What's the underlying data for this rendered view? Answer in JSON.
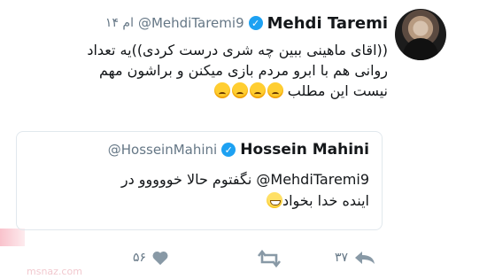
{
  "tweet": {
    "name": "Mehdi Taremi",
    "handle": "@MehdiTaremi9",
    "time": "۱۴ ام",
    "verified_glyph": "✓",
    "line1": "((اقای ماهینی ببین چه شری درست کردی))یه تعداد",
    "line2": "روانی هم با ابرو مردم بازی میکنن و براشون مهم",
    "line3": "نیست این مطلب",
    "emoji_name": "pouting-face"
  },
  "quote": {
    "name": "Hossein Mahini",
    "handle": "@HosseinMahini",
    "verified_glyph": "✓",
    "line1": "MehdiTaremi9@ نگفتوم حالا خووووو در",
    "line2": "اینده خدا بخواد",
    "emoji_name": "grinning-face"
  },
  "actions": {
    "reply_count": "",
    "retweet_count": "۳۷",
    "like_count": "۵۶"
  },
  "colors": {
    "accent": "#1da1f2",
    "muted": "#657786",
    "border": "#e1e8ed"
  },
  "watermark": "msnaz.com"
}
